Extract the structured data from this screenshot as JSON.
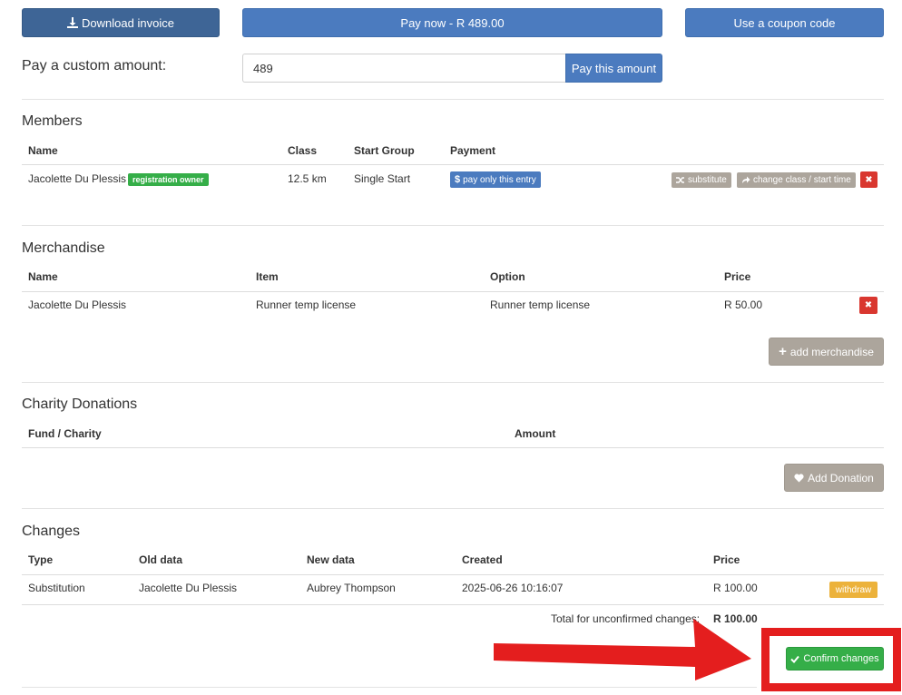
{
  "toolbar": {
    "download_label": "Download invoice",
    "pay_now_label": "Pay now - R 489.00",
    "coupon_label": "Use a coupon code"
  },
  "custom_amount": {
    "label": "Pay a custom amount:",
    "value": "489",
    "button_label": "Pay this amount"
  },
  "members": {
    "title": "Members",
    "columns": [
      "Name",
      "Class",
      "Start Group",
      "Payment"
    ],
    "rows": [
      {
        "name": "Jacolette Du Plessis",
        "badge": "registration owner",
        "class": "12.5 km",
        "start_group": "Single Start",
        "payment_action": "pay only this entry",
        "substitute_label": "substitute",
        "change_label": "change class / start time",
        "remove_label": "✖"
      }
    ]
  },
  "merchandise": {
    "title": "Merchandise",
    "columns": [
      "Name",
      "Item",
      "Option",
      "Price"
    ],
    "rows": [
      {
        "name": "Jacolette Du Plessis",
        "item": "Runner temp license",
        "option": "Runner temp license",
        "price": "R 50.00",
        "remove_label": "✖"
      }
    ],
    "add_label": "add merchandise"
  },
  "donations": {
    "title": "Charity Donations",
    "columns": [
      "Fund / Charity",
      "Amount"
    ],
    "add_label": "Add Donation"
  },
  "changes": {
    "title": "Changes",
    "columns": [
      "Type",
      "Old data",
      "New data",
      "Created",
      "Price"
    ],
    "rows": [
      {
        "type": "Substitution",
        "old": "Jacolette Du Plessis",
        "new": "Aubrey Thompson",
        "created": "2025-06-26 10:16:07",
        "price": "R 100.00",
        "action": "withdraw"
      }
    ],
    "total_label": "Total for unconfirmed changes:",
    "total_value": "R 100.00",
    "confirm_label": "Confirm changes"
  },
  "colors": {
    "primary_dark": "#3e6596",
    "primary": "#4b7bbf",
    "grey": "#aca59c",
    "success": "#35ae48",
    "danger": "#d9372f",
    "warning": "#ecb23b",
    "highlight": "#e41e1e"
  }
}
